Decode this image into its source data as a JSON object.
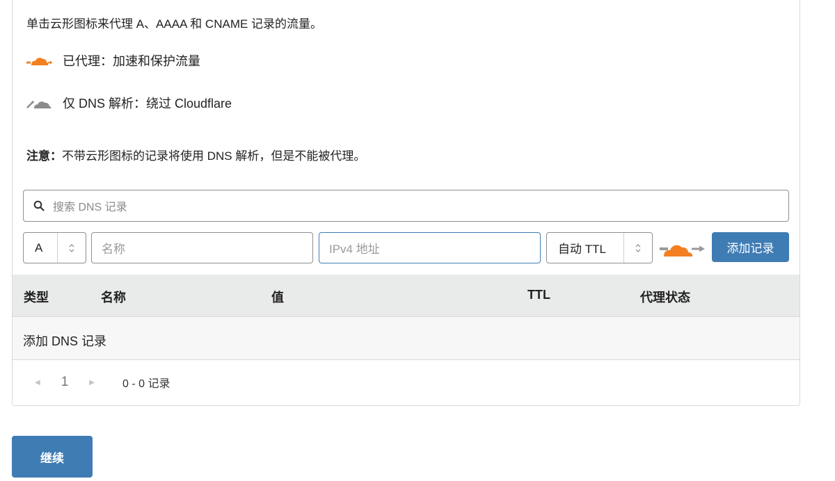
{
  "intro": {
    "text": "单击云形图标来代理 A、AAAA 和 CNAME 记录的流量。"
  },
  "legend": {
    "proxied": {
      "icon": "orange-cloud-icon",
      "label": "已代理：加速和保护流量"
    },
    "dns_only": {
      "icon": "grey-cloud-icon",
      "label": "仅 DNS 解析：绕过 Cloudflare"
    }
  },
  "note": {
    "label": "注意：",
    "text": "不带云形图标的记录将使用 DNS 解析，但是不能被代理。"
  },
  "search": {
    "placeholder": "搜索 DNS 记录",
    "icon": "search-icon"
  },
  "form": {
    "type_value": "A",
    "name_placeholder": "名称",
    "value_placeholder": "IPv4 地址",
    "ttl_value": "自动 TTL",
    "proxy_icon": "orange-cloud-toggle-icon",
    "add_button": "添加记录"
  },
  "table": {
    "headers": [
      "类型",
      "名称",
      "值",
      "TTL",
      "代理状态"
    ],
    "empty_text": "添加 DNS 记录"
  },
  "pagination": {
    "current_page": "1",
    "range_text": "0 - 0 记录"
  },
  "continue_button": "继续",
  "colors": {
    "accent": "#3f7cb4",
    "cloud_orange": "#f38020",
    "cloud_grey": "#8c8c8c",
    "header_bg": "#e9eaea"
  }
}
